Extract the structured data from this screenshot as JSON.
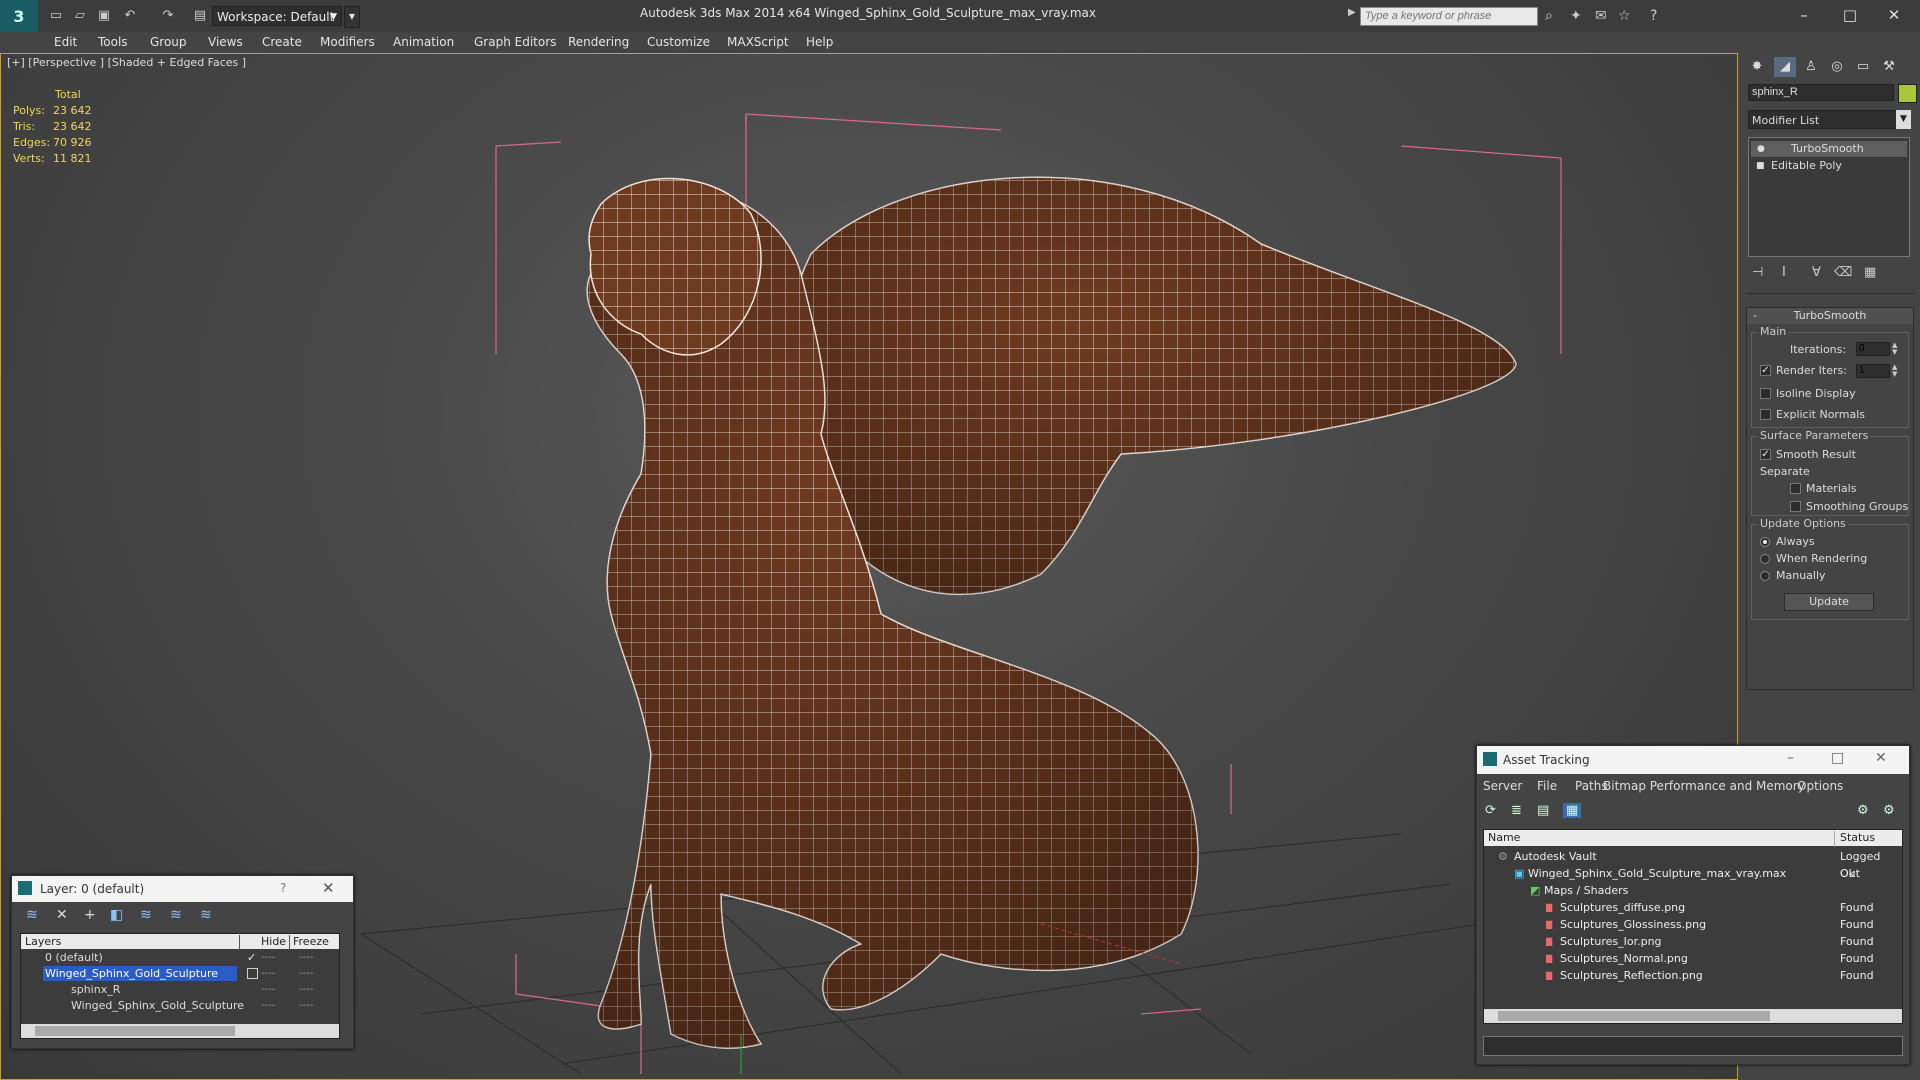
{
  "window": {
    "title": "Autodesk 3ds Max  2014 x64      Winged_Sphinx_Gold_Sculpture_max_vray.max",
    "workspace": "Workspace: Default",
    "search_placeholder": "Type a keyword or phrase"
  },
  "menu": [
    "Edit",
    "Tools",
    "Group",
    "Views",
    "Create",
    "Modifiers",
    "Animation",
    "Graph Editors",
    "Rendering",
    "Customize",
    "MAXScript",
    "Help"
  ],
  "viewport": {
    "label": "[+] [Perspective ] [Shaded + Edged Faces ]",
    "stats": {
      "total_label": "Total",
      "polys_label": "Polys:",
      "polys": "23 642",
      "tris_label": "Tris:",
      "tris": "23 642",
      "edges_label": "Edges:",
      "edges": "70 926",
      "verts_label": "Verts:",
      "verts": "11 821"
    }
  },
  "command_panel": {
    "object_name": "sphinx_R",
    "object_color": "#a8c83a",
    "modifier_list": "Modifier List",
    "stack": [
      "TurboSmooth",
      "Editable Poly"
    ],
    "rollout_title": "TurboSmooth",
    "main_group": "Main",
    "iterations_label": "Iterations:",
    "iterations": "0",
    "render_iters_label": "Render Iters:",
    "render_iters": "1",
    "isoline_label": "Isoline Display",
    "explicit_normals_label": "Explicit Normals",
    "surface_group": "Surface Parameters",
    "smooth_result_label": "Smooth Result",
    "separate_label": "Separate",
    "materials_label": "Materials",
    "smoothing_groups_label": "Smoothing Groups",
    "update_group": "Update Options",
    "always_label": "Always",
    "when_rendering_label": "When Rendering",
    "manually_label": "Manually",
    "update_button": "Update"
  },
  "layer_window": {
    "title": "Layer: 0 (default)",
    "help": "?",
    "columns": {
      "layers": "Layers",
      "hide": "Hide",
      "freeze": "Freeze"
    },
    "rows": [
      {
        "name": "0 (default)"
      },
      {
        "name": "Winged_Sphinx_Gold_Sculpture"
      },
      {
        "name": "sphinx_R"
      },
      {
        "name": "Winged_Sphinx_Gold_Sculpture"
      }
    ],
    "dash": "----"
  },
  "asset_window": {
    "title": "Asset Tracking",
    "menu": [
      "Server",
      "File",
      "Paths",
      "Bitmap Performance and Memory",
      "Options"
    ],
    "columns": {
      "name": "Name",
      "status": "Status"
    },
    "rows": [
      {
        "name": "Autodesk Vault",
        "status": "Logged Out"
      },
      {
        "name": "Winged_Sphinx_Gold_Sculpture_max_vray.max",
        "status": "Ok"
      },
      {
        "name": "Maps / Shaders",
        "status": ""
      },
      {
        "name": "Sculptures_diffuse.png",
        "status": "Found"
      },
      {
        "name": "Sculptures_Glossiness.png",
        "status": "Found"
      },
      {
        "name": "Sculptures_Ior.png",
        "status": "Found"
      },
      {
        "name": "Sculptures_Normal.png",
        "status": "Found"
      },
      {
        "name": "Sculptures_Reflection.png",
        "status": "Found"
      }
    ]
  }
}
